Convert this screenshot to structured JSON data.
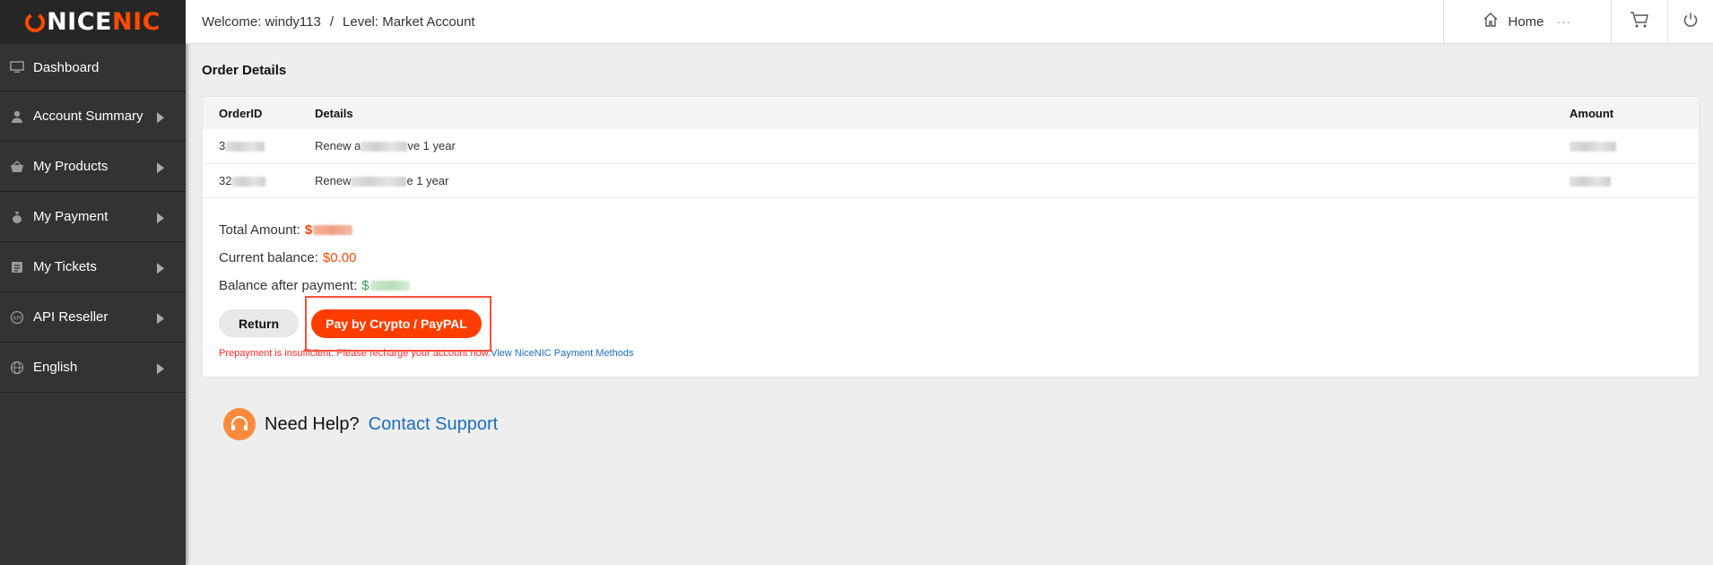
{
  "brand": {
    "logo_prefix": "NICE",
    "logo_suffix": "NIC",
    "accent_color": "#ff4a00"
  },
  "sidebar": {
    "items": [
      {
        "label": "Dashboard",
        "icon": "monitor-icon",
        "expandable": false
      },
      {
        "label": "Account Summary",
        "icon": "user-icon",
        "expandable": true
      },
      {
        "label": "My Products",
        "icon": "basket-icon",
        "expandable": true
      },
      {
        "label": "My Payment",
        "icon": "money-bag-icon",
        "expandable": true
      },
      {
        "label": "My Tickets",
        "icon": "ticket-icon",
        "expandable": true
      },
      {
        "label": "API Reseller",
        "icon": "api-icon",
        "expandable": true
      },
      {
        "label": "English",
        "icon": "globe-icon",
        "expandable": true
      }
    ]
  },
  "header": {
    "welcome": "Welcome: windy113",
    "separator": "/",
    "level": "Level: Market Account",
    "home_label": "Home",
    "more": "···"
  },
  "main": {
    "title": "Order Details",
    "table": {
      "columns": [
        "OrderID",
        "Details",
        "Amount"
      ],
      "rows": [
        {
          "order_id": "3",
          "details_prefix": "Renew a",
          "details_suffix": "ve 1 year"
        },
        {
          "order_id": "32",
          "details_prefix": "Renew",
          "details_suffix": "e 1 year"
        }
      ]
    },
    "summary": {
      "total_label": "Total Amount:",
      "total_value": "$",
      "balance_label": "Current balance:",
      "balance_value": "$0.00",
      "after_label": "Balance after payment:",
      "after_value": "$"
    },
    "buttons": {
      "return": "Return",
      "pay": "Pay by Crypto / PayPAL"
    },
    "notice": "Prepayment is insufficient. Please recharge your account now.",
    "notice_link": "View NiceNIC Payment Methods",
    "help": {
      "text": "Need Help?",
      "link": "Contact Support"
    }
  }
}
